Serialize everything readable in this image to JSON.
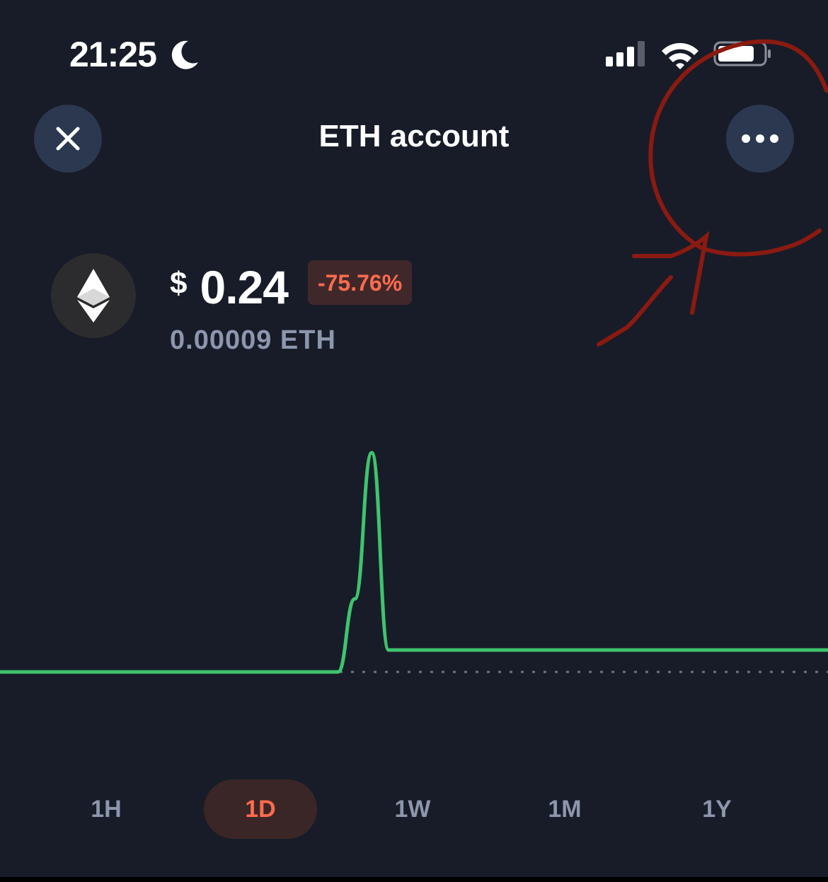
{
  "status_bar": {
    "time": "21:25",
    "icons": [
      "moon-icon",
      "signal-icon",
      "wifi-icon",
      "battery-icon"
    ]
  },
  "header": {
    "title": "ETH account",
    "close_icon": "close-icon",
    "more_icon": "more-icon"
  },
  "account": {
    "coin_icon": "ethereum-icon",
    "currency_symbol": "$",
    "fiat_value": "0.24",
    "change_percent": "-75.76%",
    "crypto_amount": "0.00009 ETH"
  },
  "chart_data": {
    "type": "line",
    "baseline": 0,
    "values": [
      0,
      0,
      0,
      0,
      0,
      0,
      0,
      0,
      0,
      0,
      0,
      0,
      0,
      0,
      0,
      0,
      0,
      0,
      0,
      0,
      0,
      1.0,
      3.0,
      0.3,
      0.3,
      0.3,
      0.3,
      0.3,
      0.3,
      0.3,
      0.3,
      0.3,
      0.3,
      0.3,
      0.3,
      0.3,
      0.3,
      0.3,
      0.3,
      0.3,
      0.3,
      0.3,
      0.3,
      0.3,
      0.3,
      0.3,
      0.3,
      0.3,
      0.3,
      0.3
    ],
    "grid": false,
    "line_color": "#3ec46d",
    "baseline_color": "#6b7388"
  },
  "range_tabs": {
    "items": [
      "1H",
      "1D",
      "1W",
      "1M",
      "1Y"
    ],
    "active": "1D"
  },
  "colors": {
    "background": "#181c28",
    "button_bg": "#2b3850",
    "accent_negative": "#ff6b4e",
    "muted_text": "#8c96ac",
    "annotation": "#8b1a10"
  }
}
